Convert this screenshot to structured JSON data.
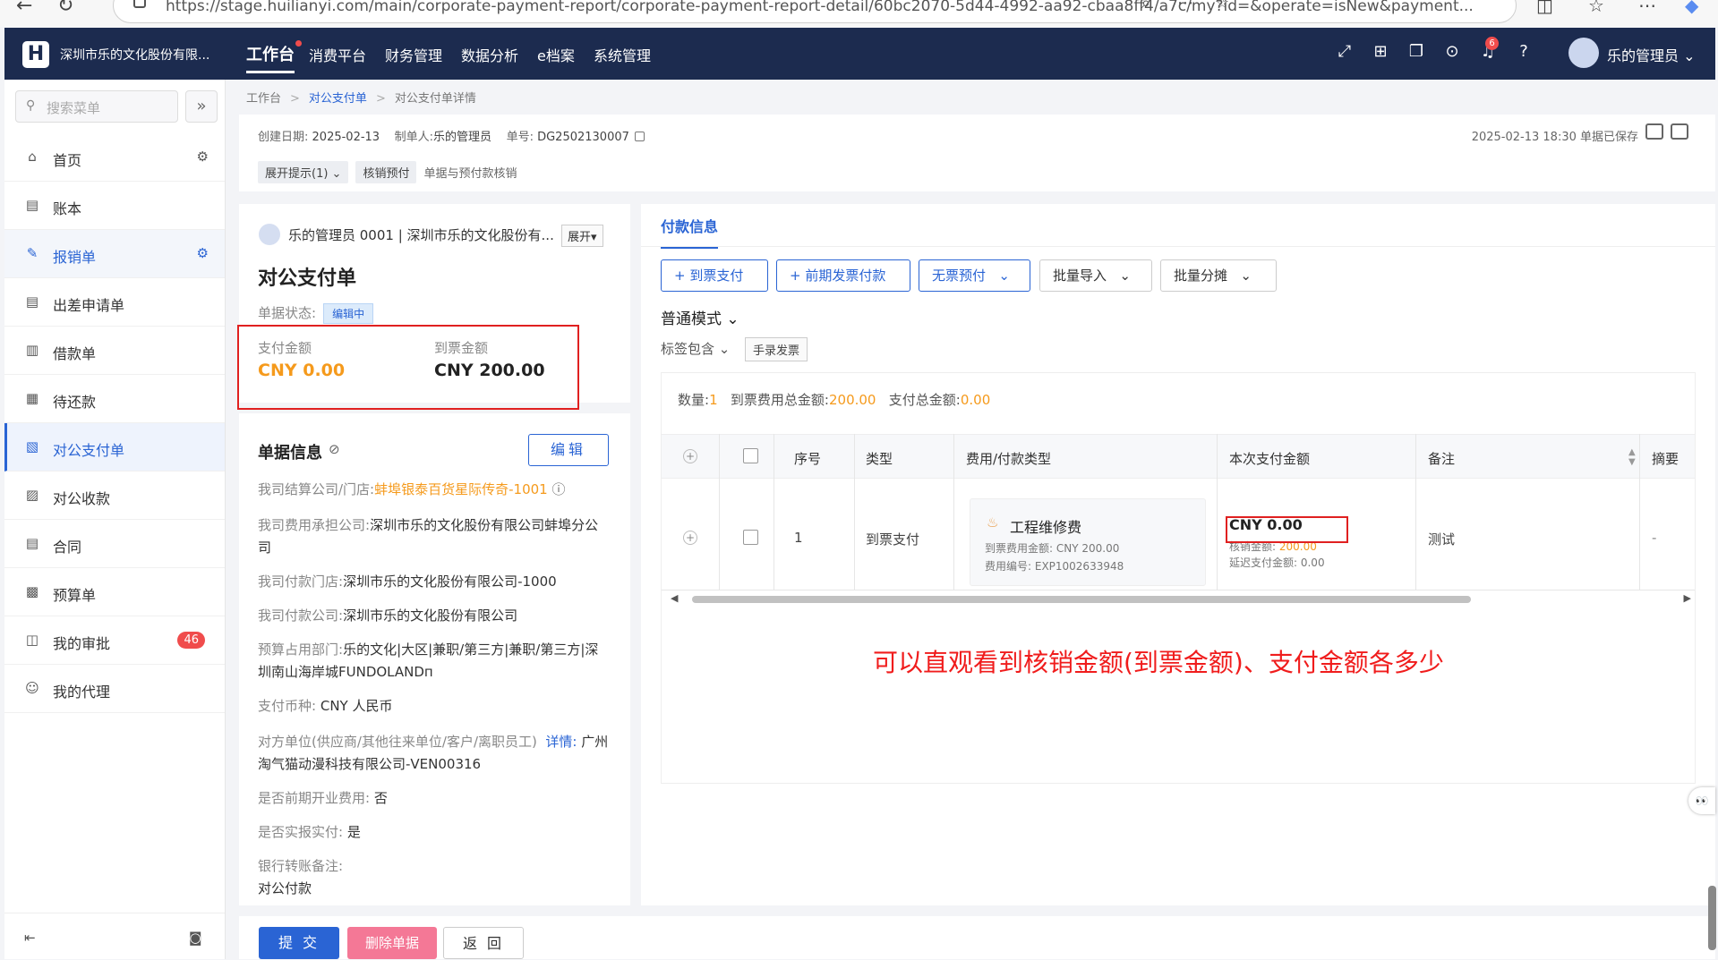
{
  "browser": {
    "url": "https://stage.huilianyi.com/main/corporate-payment-report/corporate-payment-report-detail/60bc2070-5d44-4992-aa92-cbaa8ff4/a7c/my?id=&operate=isNew&payment..."
  },
  "topbar": {
    "company": "深圳市乐的文化股份有限...",
    "nav": [
      "工作台",
      "消费平台",
      "财务管理",
      "数据分析",
      "e档案",
      "系统管理"
    ],
    "notif_count": "6",
    "user": "乐的管理员"
  },
  "sidebar": {
    "search_placeholder": "搜索菜单",
    "items": [
      "首页",
      "账本",
      "报销单",
      "出差申请单",
      "借款单",
      "待还款",
      "对公支付单",
      "对公收款",
      "合同",
      "预算单",
      "我的审批",
      "我的代理"
    ],
    "approval_count": "46"
  },
  "breadcrumb": [
    "工作台",
    "对公支付单",
    "对公支付单详情"
  ],
  "infobar": {
    "created": "创建日期:",
    "created_v": "2025-02-13",
    "maker": "制单人:",
    "maker_v": "乐的管理员",
    "no": "单号:",
    "no_v": "DG2502130007",
    "saved": "2025-02-13 18:30 单据已保存",
    "tag1": "展开提示(1)",
    "tag2": "核销预付",
    "tag_text": "单据与预付款核销"
  },
  "doc": {
    "owner": "乐的管理员 0001 | 深圳市乐的文化股份有...",
    "expand": "展开",
    "title": "对公支付单",
    "status_label": "单据状态:",
    "status": "编辑中",
    "pay_label": "支付金额",
    "pay_value": "CNY 0.00",
    "inv_label": "到票金额",
    "inv_value": "CNY 200.00"
  },
  "info": {
    "title": "单据信息",
    "edit": "编辑",
    "fields": [
      {
        "l": "我司结算公司/门店:",
        "v": "蚌埠银泰百货星际传奇-1001"
      },
      {
        "l": "我司费用承担公司:",
        "v": "深圳市乐的文化股份有限公司蚌埠分公司"
      },
      {
        "l": "我司付款门店:",
        "v": "深圳市乐的文化股份有限公司-1000"
      },
      {
        "l": "我司付款公司:",
        "v": "深圳市乐的文化股份有限公司"
      },
      {
        "l": "预算占用部门:",
        "v": "乐的文化|大区|兼职/第三方|兼职/第三方|深圳南山海岸城FUNDOLANDп"
      },
      {
        "l": "支付币种:",
        "v": "CNY 人民币"
      },
      {
        "l": "对方单位(供应商/其他往来单位/客户/离职员工)",
        "link": "详情:",
        "v": "广州淘气猫动漫科技有限公司-VEN00316"
      },
      {
        "l": "是否前期开业费用:",
        "v": "否"
      },
      {
        "l": "是否实报实付:",
        "v": "是"
      },
      {
        "l": "银行转账备注:",
        "v": "对公付款"
      }
    ]
  },
  "payment": {
    "tab": "付款信息",
    "buttons": [
      "+ 到票支付",
      "+ 前期发票付款",
      "无票预付",
      "批量导入",
      "批量分摊"
    ],
    "mode": "普通模式",
    "tag_filter": "标签包含",
    "manual": "手录发票",
    "summary": {
      "count_l": "数量:",
      "count": "1",
      "inv_total_l": "到票费用总金额:",
      "inv_total": "200.00",
      "pay_total_l": "支付总金额:",
      "pay_total": "0.00"
    },
    "columns": [
      "序号",
      "类型",
      "费用/付款类型",
      "本次支付金额",
      "备注",
      "摘要"
    ],
    "row": {
      "seq": "1",
      "type": "到票支付",
      "expense": "工程维修费",
      "exp_amt": "到票费用金额: CNY 200.00",
      "exp_no": "费用编号: EXP1002633948",
      "pay": "CNY 0.00",
      "writeoff_l": "核销金额:",
      "writeoff": "200.00",
      "delay": "延迟支付金额: 0.00",
      "remark": "测试",
      "summary": "-"
    }
  },
  "annotation": "可以直观看到核销金额(到票金额)、支付金额各多少",
  "bottom": {
    "submit": "提 交",
    "delete": "删除单据",
    "back": "返 回"
  }
}
